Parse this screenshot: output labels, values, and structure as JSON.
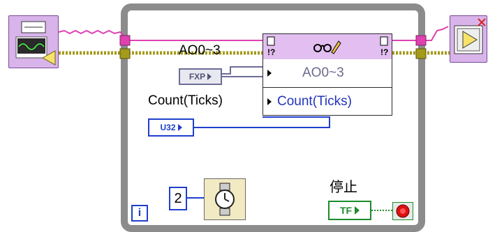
{
  "diagram": {
    "loop": {
      "type": "while-loop",
      "iteration_label": "i"
    },
    "property_node": {
      "rows": [
        {
          "label": "AO0~3",
          "color": "#6a6a8e"
        },
        {
          "label": "Count(Ticks)",
          "color": "#2233bb"
        }
      ]
    },
    "labels": {
      "ao_control": "AO0~3",
      "count_control": "Count(Ticks)",
      "stop_label": "停止"
    },
    "terminals": {
      "fxp": "FXP",
      "u32": "U32",
      "const_value": "2",
      "tf": "TF"
    },
    "colors": {
      "loop_border": "#8c8c8c",
      "dynamic_wire": "#e040b0",
      "error_wire": "#a49a1c",
      "fxp_wire": "#6c6c98",
      "u32_wire": "#1f3fcc",
      "bool_wire": "#1c8c2c",
      "property_node_header": "#e2bff0",
      "stop_button": "#dd1111"
    },
    "icons": [
      "signal-input-vi-icon",
      "property-node-icon",
      "wait-ms-icon",
      "signal-output-vi-icon",
      "stop-button-icon"
    ]
  }
}
